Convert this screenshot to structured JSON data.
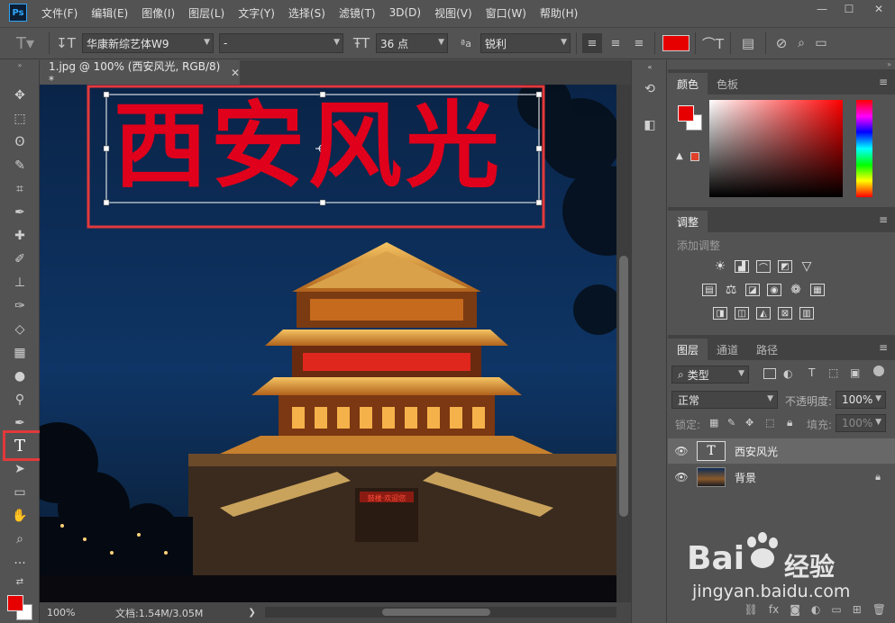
{
  "app": {
    "logo": "Ps",
    "menu": [
      "文件(F)",
      "编辑(E)",
      "图像(I)",
      "图层(L)",
      "文字(Y)",
      "选择(S)",
      "滤镜(T)",
      "3D(D)",
      "视图(V)",
      "窗口(W)",
      "帮助(H)"
    ],
    "window_controls": {
      "minimize": "—",
      "maximize": "☐",
      "close": "✕"
    }
  },
  "options_bar": {
    "font_family": "华康新综艺体W9",
    "font_style": "-",
    "font_size": "36 点",
    "aa_label": "ªa",
    "antialias": "锐利",
    "text_color": "#e60000"
  },
  "document": {
    "tab_title": "1.jpg @ 100% (西安风光, RGB/8) *",
    "tab_close": "✕",
    "headline": "西安风光",
    "headline_color": "#e0001b",
    "sign_text": "鼓楼·欢迎您"
  },
  "statusbar": {
    "zoom": "100%",
    "doc_size": "文档:1.54M/3.05M",
    "arrow": "❯"
  },
  "panels": {
    "color": {
      "tabs": [
        "颜色",
        "色板"
      ],
      "foreground": "#e60000",
      "background": "#ffffff",
      "warning_icon": "▲"
    },
    "adjustments": {
      "title": "调整",
      "add_label": "添加调整"
    },
    "layers": {
      "tabs": [
        "图层",
        "通道",
        "路径"
      ],
      "filter_label": "类型",
      "blend_mode": "正常",
      "opacity_label": "不透明度:",
      "opacity_value": "100%",
      "lock_label": "锁定:",
      "fill_label": "填充:",
      "fill_value": "100%",
      "items": [
        {
          "name": "西安风光",
          "thumb": "T",
          "selected": true
        },
        {
          "name": "背景",
          "thumb": "",
          "selected": false
        }
      ]
    }
  },
  "watermark": {
    "brand": "Bai",
    "brand_cn": "经验",
    "url": "jingyan.baidu.com"
  }
}
